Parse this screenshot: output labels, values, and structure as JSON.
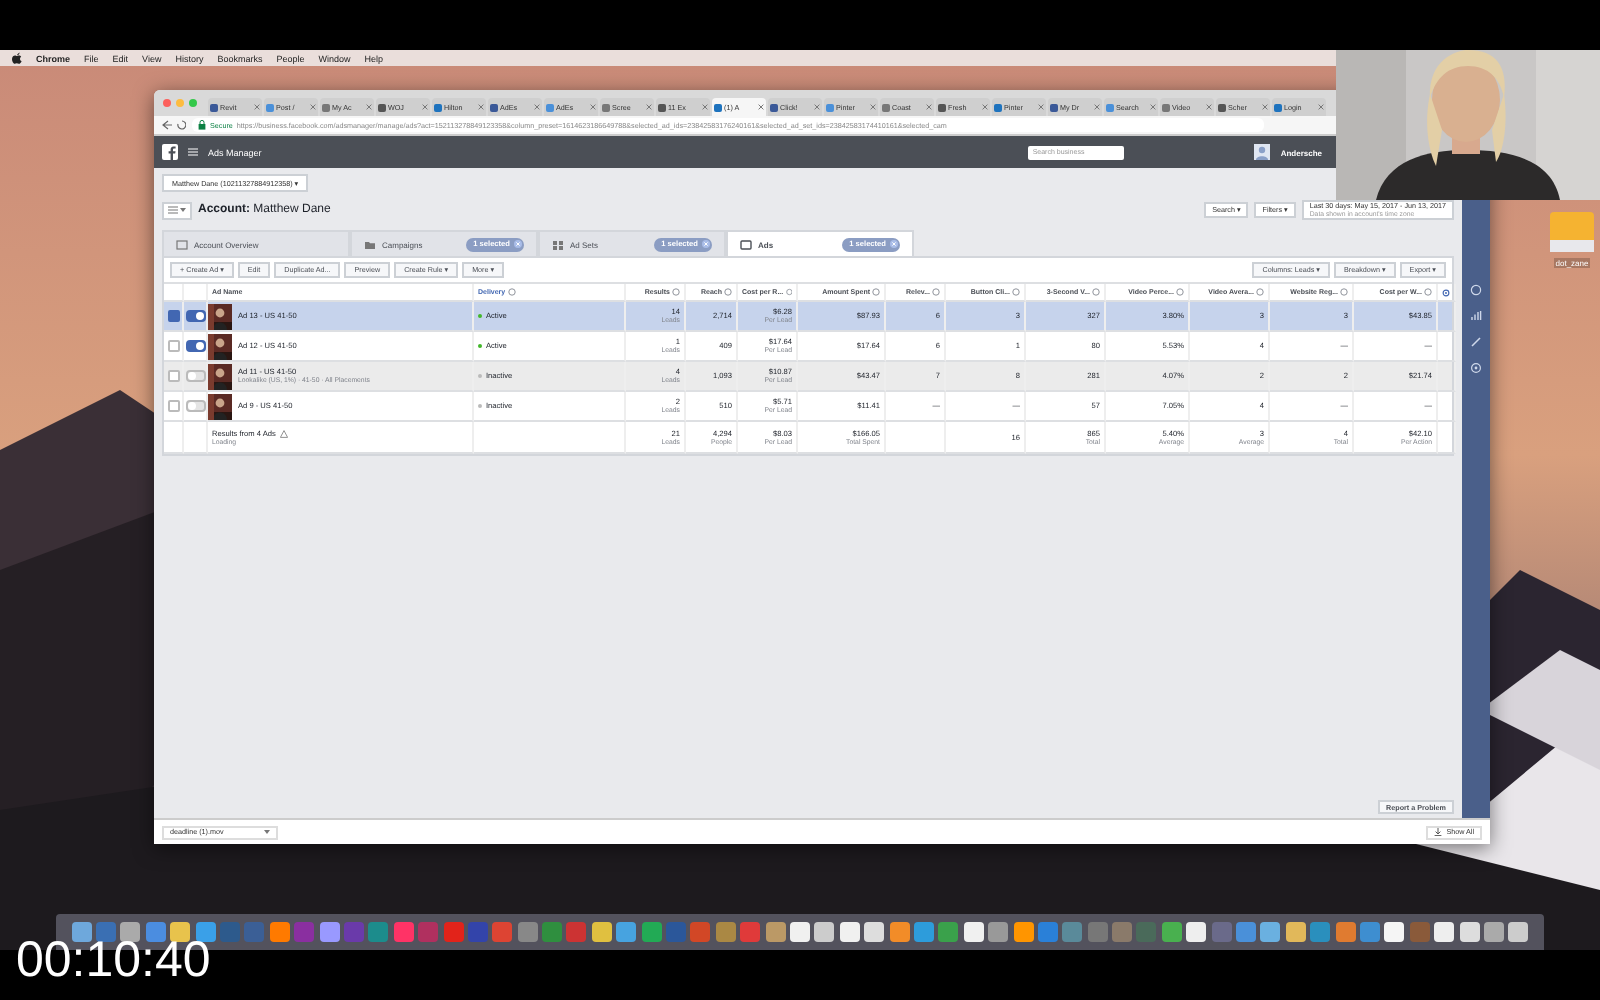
{
  "menubar": {
    "items": [
      "Chrome",
      "File",
      "Edit",
      "View",
      "History",
      "Bookmarks",
      "People",
      "Window",
      "Help"
    ]
  },
  "browser": {
    "tabs": [
      {
        "label": "Revit",
        "selected": false
      },
      {
        "label": "Post /",
        "selected": false
      },
      {
        "label": "My Ac",
        "selected": false
      },
      {
        "label": "WOJ",
        "selected": false
      },
      {
        "label": "Hilton",
        "selected": false
      },
      {
        "label": "AdEs",
        "selected": false
      },
      {
        "label": "AdEs",
        "selected": false
      },
      {
        "label": "Scree",
        "selected": false
      },
      {
        "label": "11 Ex",
        "selected": false
      },
      {
        "label": "(1) A",
        "selected": true
      },
      {
        "label": "Click!",
        "selected": false
      },
      {
        "label": "Pinter",
        "selected": false
      },
      {
        "label": "Coast",
        "selected": false
      },
      {
        "label": "Fresh",
        "selected": false
      },
      {
        "label": "Pinter",
        "selected": false
      },
      {
        "label": "My Dr",
        "selected": false
      },
      {
        "label": "Search",
        "selected": false
      },
      {
        "label": "Video",
        "selected": false
      },
      {
        "label": "Scher",
        "selected": false
      },
      {
        "label": "Login",
        "selected": false
      }
    ],
    "address": {
      "secure": "Secure",
      "url": "https://business.facebook.com/adsmanager/manage/ads?act=152113278849123358&column_preset=1614623186649788&selected_ad_ids=23842583176240161&selected_ad_set_ids=23842583174410161&selected_cam"
    }
  },
  "app": {
    "title": "Ads Manager",
    "search": {
      "placeholder": "Search business"
    },
    "user": "Andersche"
  },
  "account_selector": "Matthew Dane (10211327884912358) ▾",
  "heading": {
    "label": "Account:",
    "name": "Matthew Dane"
  },
  "header_buttons": [
    "Search ▾",
    "Filters ▾"
  ],
  "date_range": {
    "label": "Last 30 days: May 15, 2017 - Jun 13, 2017",
    "note": "Data shown in account's time zone"
  },
  "level_tabs": [
    {
      "label": "Account Overview",
      "selected": false
    },
    {
      "label": "Campaigns",
      "badge": "1 selected",
      "selected": false
    },
    {
      "label": "Ad Sets",
      "badge": "1 selected",
      "selected": false
    },
    {
      "label": "Ads",
      "badge": "1 selected",
      "selected": true
    }
  ],
  "toolbar": {
    "actions": [
      "+ Create Ad ▾",
      "Edit",
      "Duplicate Ad...",
      "Preview",
      "Create Rule ▾",
      "More ▾"
    ],
    "views": [
      "Columns: Leads ▾",
      "Breakdown ▾",
      "Export ▾"
    ]
  },
  "table": {
    "columns": [
      "Ad Name",
      "Delivery",
      "Results",
      "Reach",
      "Cost per R...",
      "Amount Spent",
      "Relev...",
      "Button Cli...",
      "3-Second V...",
      "Video Perce...",
      "Video Avera...",
      "Website Reg...",
      "Cost per W..."
    ],
    "rows": [
      {
        "selected": true,
        "highlighted": false,
        "on": true,
        "cells": [
          [
            "Ad 13 - US 41-50"
          ],
          [
            "Active"
          ],
          [
            "14",
            "Leads"
          ],
          [
            "2,714"
          ],
          [
            "$6.28",
            "Per Lead"
          ],
          [
            "$87.93"
          ],
          [
            "6"
          ],
          [
            "3"
          ],
          [
            "327"
          ],
          [
            "3.80%"
          ],
          [
            "3"
          ],
          [
            "3"
          ],
          [
            "$43.85"
          ]
        ]
      },
      {
        "selected": false,
        "highlighted": false,
        "on": true,
        "cells": [
          [
            "Ad 12 - US 41-50"
          ],
          [
            "Active"
          ],
          [
            "1",
            "Leads"
          ],
          [
            "409"
          ],
          [
            "$17.64",
            "Per Lead"
          ],
          [
            "$17.64"
          ],
          [
            "6"
          ],
          [
            "1"
          ],
          [
            "80"
          ],
          [
            "5.53%"
          ],
          [
            "4"
          ],
          [
            "—"
          ],
          [
            "—"
          ]
        ]
      },
      {
        "selected": false,
        "highlighted": true,
        "on": false,
        "cells": [
          [
            "Ad 11 - US 41-50",
            "Lookalike (US, 1%) · 41-50 · All Placements"
          ],
          [
            "Inactive"
          ],
          [
            "4",
            "Leads"
          ],
          [
            "1,093"
          ],
          [
            "$10.87",
            "Per Lead"
          ],
          [
            "$43.47"
          ],
          [
            "7"
          ],
          [
            "8"
          ],
          [
            "281"
          ],
          [
            "4.07%"
          ],
          [
            "2"
          ],
          [
            "2"
          ],
          [
            "$21.74"
          ]
        ]
      },
      {
        "selected": false,
        "highlighted": false,
        "on": false,
        "cells": [
          [
            "Ad 9 - US 41-50"
          ],
          [
            "Inactive"
          ],
          [
            "2",
            "Leads"
          ],
          [
            "510"
          ],
          [
            "$5.71",
            "Per Lead"
          ],
          [
            "$11.41"
          ],
          [
            "—"
          ],
          [
            "—"
          ],
          [
            "57"
          ],
          [
            "7.05%"
          ],
          [
            "4"
          ],
          [
            "—"
          ],
          [
            "—"
          ]
        ]
      }
    ],
    "summary": {
      "cells": [
        [
          "Results from 4 Ads",
          "Loading"
        ],
        [
          ""
        ],
        [
          "21",
          "Leads"
        ],
        [
          "4,294",
          "People"
        ],
        [
          "$8.03",
          "Per Lead"
        ],
        [
          "$166.05",
          "Total Spent"
        ],
        [
          ""
        ],
        [
          "16"
        ],
        [
          "865",
          "Total"
        ],
        [
          "5.40%",
          "Average"
        ],
        [
          "3",
          "Average"
        ],
        [
          "4",
          "Total"
        ],
        [
          "$42.10",
          "Per Action"
        ]
      ]
    }
  },
  "footer": {
    "report": "Report a Problem"
  },
  "downloads": {
    "file": "deadline (1).mov",
    "show_all": "Show All"
  },
  "desktop_icon": "dot_zane",
  "timecode": "00:10:40"
}
